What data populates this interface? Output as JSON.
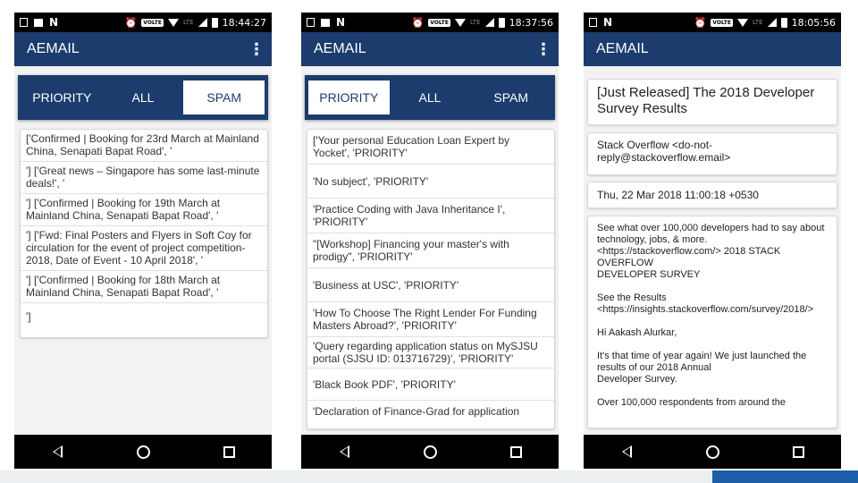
{
  "colors": {
    "appbar": "#1d3c6e",
    "accent_strip": "#1d5ea8"
  },
  "screens": [
    {
      "status": {
        "time": "18:44:27",
        "volte": "VOLTE",
        "lte": "LTE"
      },
      "app_title": "AEMAIL",
      "menu_icon": "⋮",
      "tabs": [
        {
          "label": "PRIORITY",
          "active": false
        },
        {
          "label": "ALL",
          "active": false
        },
        {
          "label": "SPAM",
          "active": true
        }
      ],
      "items": [
        "['Confirmed | Booking for 23rd March at Mainland China, Senapati Bapat Road', '",
        "'] ['Great news – Singapore has some last-minute deals!', '",
        "'] ['Confirmed | Booking for 19th March at Mainland China, Senapati Bapat Road', '",
        "'] ['Fwd: Final Posters and Flyers in Soft Coy for circulation for the event of project competition-2018, Date of Event - 10 April 2018', '",
        "'] ['Confirmed | Booking for 18th March at Mainland China, Senapati Bapat Road', '",
        "']"
      ]
    },
    {
      "status": {
        "time": "18:37:56",
        "volte": "VOLTE",
        "lte": "LTE"
      },
      "app_title": "AEMAIL",
      "menu_icon": "⋮",
      "tabs": [
        {
          "label": "PRIORITY",
          "active": true
        },
        {
          "label": "ALL",
          "active": false
        },
        {
          "label": "SPAM",
          "active": false
        }
      ],
      "items": [
        "['Your personal Education Loan Expert by Yocket', 'PRIORITY'",
        "'No subject', 'PRIORITY'",
        "'Practice Coding with Java Inheritance I', 'PRIORITY'",
        "\"[Workshop] Financing your master's with prodigy\", 'PRIORITY'",
        "'Business at USC', 'PRIORITY'",
        "'How To Choose The Right Lender For Funding Masters Abroad?', 'PRIORITY'",
        "'Query regarding application status on MySJSU portal (SJSU ID: 013716729)', 'PRIORITY'",
        "'Black Book PDF', 'PRIORITY'",
        "'Declaration of Finance-Grad for application"
      ]
    },
    {
      "status": {
        "time": "18:05:56",
        "volte": "VOLTE",
        "lte": "LTE"
      },
      "app_title": "AEMAIL",
      "subject": "[Just Released] The 2018 Developer Survey Results",
      "from": "Stack Overflow <do-not-reply@stackoverflow.email>",
      "date": "Thu, 22 Mar 2018 11:00:18 +0530",
      "body": [
        "See what over 100,000 developers had to say about technology, jobs, & more. <https://stackoverflow.com/> 2018 STACK OVERFLOW\nDEVELOPER SURVEY",
        "See the Results  <https://insights.stackoverflow.com/survey/2018/>",
        "Hi Aakash Alurkar,",
        "It's that time of year again! We just launched the results of our 2018 Annual\nDeveloper Survey.",
        "Over 100,000 respondents from around the"
      ]
    }
  ]
}
